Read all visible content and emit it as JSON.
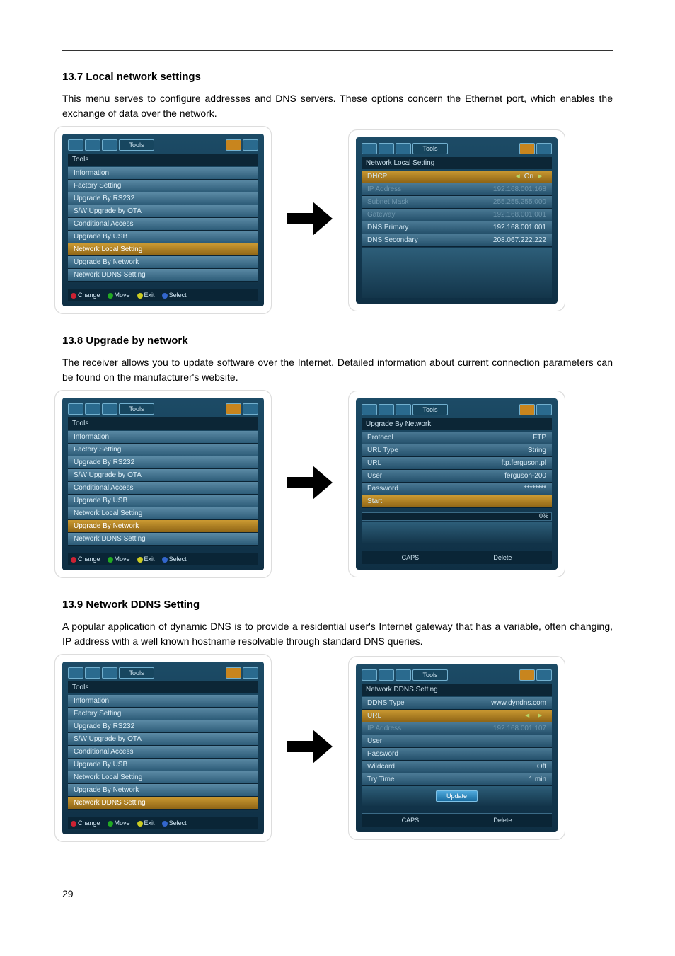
{
  "section137": {
    "heading": "13.7 Local network settings",
    "text": "This menu serves to configure addresses and DNS servers. These options concern the Ethernet port, which enables the exchange of data over the network."
  },
  "section138": {
    "heading": "13.8 Upgrade by network",
    "text": "The receiver allows you to update software over the Internet. Detailed information about current connection parameters can be found on the manufacturer's website."
  },
  "section139": {
    "heading": "13.9 Network DDNS Setting",
    "text": "A popular application of dynamic DNS is to provide a residential user's Internet gateway that has a variable, often changing, IP address with a well known hostname resolvable through standard DNS queries."
  },
  "tabLabel": "Tools",
  "toolsTitle": "Tools",
  "toolsMenu": {
    "items": [
      "Information",
      "Factory Setting",
      "Upgrade By RS232",
      "S/W Upgrade by OTA",
      "Conditional Access",
      "Upgrade By USB",
      "Network Local Setting",
      "Upgrade By Network",
      "Network DDNS Setting"
    ]
  },
  "footerNav": {
    "change": "Change",
    "move": "Move",
    "exit": "Exit",
    "select": "Select"
  },
  "networkLocal": {
    "title": "Network Local Setting",
    "rows": [
      {
        "k": "DHCP",
        "v": "On",
        "sel": true,
        "pick": true
      },
      {
        "k": "IP Address",
        "v": "192.168.001.168",
        "dim": true
      },
      {
        "k": "Subnet Mask",
        "v": "255.255.255.000",
        "dim": true
      },
      {
        "k": "Gateway",
        "v": "192.168.001.001",
        "dim": true
      },
      {
        "k": "DNS Primary",
        "v": "192.168.001.001"
      },
      {
        "k": "DNS Secondary",
        "v": "208.067.222.222"
      }
    ]
  },
  "upgradeNet": {
    "title": "Upgrade By Network",
    "rows": [
      {
        "k": "Protocol",
        "v": "FTP"
      },
      {
        "k": "URL Type",
        "v": "String"
      },
      {
        "k": "URL",
        "v": "ftp.ferguson.pl"
      },
      {
        "k": "User",
        "v": "ferguson-200"
      },
      {
        "k": "Password",
        "v": "********"
      },
      {
        "k": "Start",
        "v": "",
        "sel": true
      }
    ],
    "progress": "0%",
    "caps": "CAPS",
    "delete": "Delete"
  },
  "ddns": {
    "title": "Network DDNS Setting",
    "rows": [
      {
        "k": "DDNS Type",
        "v": "www.dyndns.com"
      },
      {
        "k": "URL",
        "v": "",
        "sel": true,
        "pick": true
      },
      {
        "k": "IP Address",
        "v": "192.168.001.107",
        "dim": true
      },
      {
        "k": "User",
        "v": ""
      },
      {
        "k": "Password",
        "v": ""
      },
      {
        "k": "Wildcard",
        "v": "Off"
      },
      {
        "k": "Try Time",
        "v": "1 min"
      }
    ],
    "update": "Update",
    "caps": "CAPS",
    "delete": "Delete"
  },
  "pageNum": "29"
}
